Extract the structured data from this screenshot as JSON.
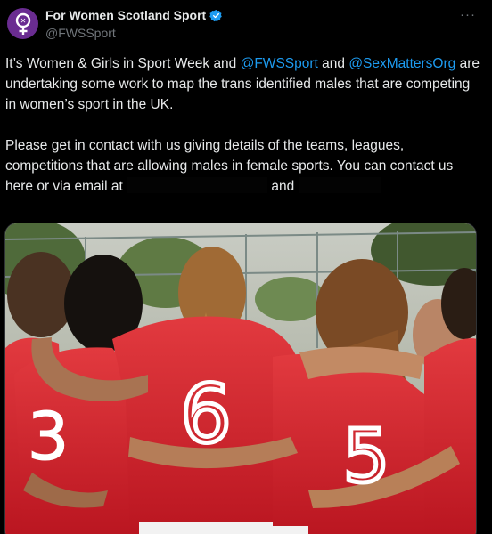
{
  "author": {
    "display_name": "For Women Scotland Sport",
    "handle": "@FWSSport",
    "avatar_icon": "venus-symbol-icon",
    "verified_icon": "verified-badge-icon",
    "accent_color": "#1d9bf0",
    "avatar_color": "#6a2c91"
  },
  "menu": {
    "more_label": "···"
  },
  "tweet": {
    "p1_a": "It’s Women & Girls in Sport Week and ",
    "p1_mention1": "@FWSSport",
    "p1_b": " and ",
    "p1_mention2": "@SexMattersOrg",
    "p1_c": " are undertaking some work to map the trans identified males that are competing in women’s sport in the UK.",
    "p2_a": "Please get in contact with us giving details of the teams, leagues, competitions that are allowing males in female sports. You can contact us here or via email at ",
    "p2_b": " and "
  },
  "media": {
    "description_icon": "team-huddle-photo",
    "jersey_numbers": [
      "3",
      "6",
      "5"
    ],
    "jersey_color": "#d71f2b"
  }
}
